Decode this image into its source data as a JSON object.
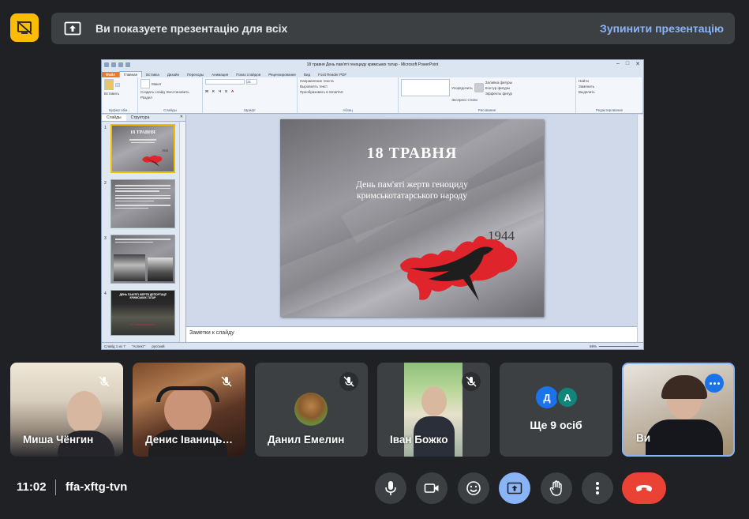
{
  "banner": {
    "text": "Ви показуете презентацію для всіх",
    "stop_label": "Зупинити презентацію"
  },
  "ppt": {
    "window_title": "18 травня День пам'яті геноциду кримських татар  -  Microsoft PowerPoint",
    "tabs": [
      "Файл",
      "Главная",
      "Вставка",
      "Дизайн",
      "Переходы",
      "Анимация",
      "Показ слайдов",
      "Рецензирование",
      "Вид",
      "Foxit Reader PDF"
    ],
    "active_tab": "Главная",
    "ribbon": {
      "paste": "Вставить",
      "new_slide": "Создать слайд",
      "layout": "Макет",
      "reset": "Восстановить",
      "section": "Раздел",
      "font_size": "28",
      "text_direction": "Направление текста",
      "align_text": "Выровнять текст",
      "smartart": "Преобразовать в SmartArt",
      "arrange": "Упорядочить",
      "quick_styles": "Экспресс-стили",
      "shape_fill": "Заливка фигуры",
      "shape_outline": "Контур фигуры",
      "shape_effects": "Эффекты фигур",
      "find": "Найти",
      "replace": "Заменить",
      "select": "Выделить",
      "groups": {
        "clipboard": "Буфер обм...",
        "slides": "Слайды",
        "font": "Шрифт",
        "paragraph": "Абзац",
        "drawing": "Рисование",
        "editing": "Редактирование"
      }
    },
    "panel_tabs": [
      "Слайды",
      "Структура"
    ],
    "slide_numbers": [
      "1",
      "2",
      "3",
      "4"
    ],
    "thumb1": {
      "title": "18 ТРАВНЯ",
      "year": "1944"
    },
    "thumb4": {
      "title": "ДЕНЬ ПАМ'ЯТІ ЖЕРТВ ДЕПОРТАЦІЇ КРИМСЬКИХ ТАТАР",
      "date": "18 ТРАВНЯ 1944 РОКУ"
    },
    "slide": {
      "title": "18 ТРАВНЯ",
      "subtitle_line1": "День пам'яті жертв геноциду",
      "subtitle_line2": "кримськотатарського народу",
      "year": "1944"
    },
    "notes_placeholder": "Заметки к слайду",
    "status": {
      "slide": "Слайд 1 из 7",
      "theme": "\"Аспект\"",
      "lang": "русский",
      "zoom": "69%"
    }
  },
  "participants": [
    {
      "name": "Миша Чёнгин"
    },
    {
      "name": "Денис Іваницький"
    },
    {
      "name": "Данил Емелин"
    },
    {
      "name": "Іван Божко"
    },
    {
      "name": "Ще 9 осіб",
      "initials": [
        "Д",
        "А"
      ]
    },
    {
      "name": "Ви"
    }
  ],
  "meeting": {
    "time": "11:02",
    "code": "ffa-xftg-tvn"
  },
  "colors": {
    "accent_blue": "#8ab4f8",
    "hangup_red": "#ea4335",
    "warning_yellow": "#fbbc04",
    "brand_red": "#e0242b"
  }
}
